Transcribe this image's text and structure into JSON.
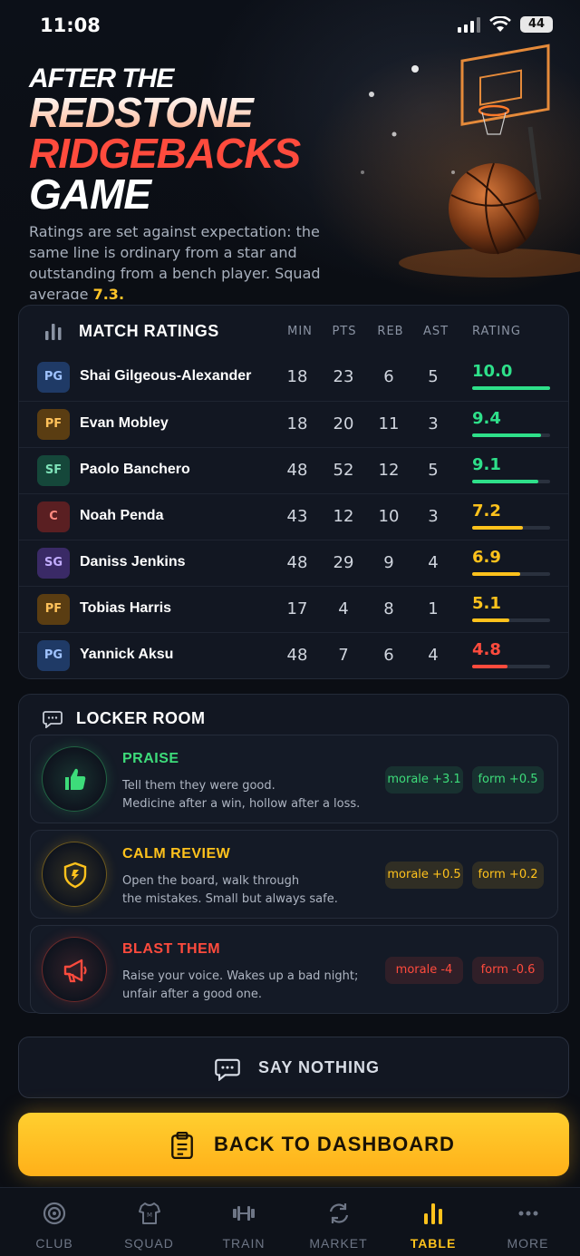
{
  "status": {
    "time": "11:08",
    "battery": "44"
  },
  "hero": {
    "title_line1": "AFTER THE",
    "title_line2": "REDSTONE",
    "title_line3": "RIDGEBACKS",
    "title_line4": "GAME",
    "subtitle": "Ratings are set against expectation: the same line is ordinary from a star and outstanding from a bench player. Squad average ",
    "squad_average": "7.3."
  },
  "ratings": {
    "title": "MATCH RATINGS",
    "columns": [
      "MIN",
      "PTS",
      "REB",
      "AST",
      "RATING"
    ],
    "players": [
      {
        "pos": "PG",
        "name": "Shai Gilgeous-Alexander",
        "min": "18",
        "pts": "23",
        "reb": "6",
        "ast": "5",
        "rating": "10.0",
        "level": 1.0,
        "color": "#2ee08a"
      },
      {
        "pos": "PF",
        "name": "Evan Mobley",
        "min": "18",
        "pts": "20",
        "reb": "11",
        "ast": "3",
        "rating": "9.4",
        "level": 0.88,
        "color": "#2ee08a"
      },
      {
        "pos": "SF",
        "name": "Paolo Banchero",
        "min": "48",
        "pts": "52",
        "reb": "12",
        "ast": "5",
        "rating": "9.1",
        "level": 0.85,
        "color": "#2ee08a"
      },
      {
        "pos": "C",
        "name": "Noah Penda",
        "min": "43",
        "pts": "12",
        "reb": "10",
        "ast": "3",
        "rating": "7.2",
        "level": 0.65,
        "color": "#ffc21c"
      },
      {
        "pos": "SG",
        "name": "Daniss Jenkins",
        "min": "48",
        "pts": "29",
        "reb": "9",
        "ast": "4",
        "rating": "6.9",
        "level": 0.62,
        "color": "#ffc21c"
      },
      {
        "pos": "PF",
        "name": "Tobias Harris",
        "min": "17",
        "pts": "4",
        "reb": "8",
        "ast": "1",
        "rating": "5.1",
        "level": 0.48,
        "color": "#ffc21c"
      },
      {
        "pos": "PG",
        "name": "Yannick Aksu",
        "min": "48",
        "pts": "7",
        "reb": "6",
        "ast": "4",
        "rating": "4.8",
        "level": 0.45,
        "color": "#ff4b3d"
      }
    ]
  },
  "locker": {
    "title": "LOCKER ROOM",
    "options": [
      {
        "title": "PRAISE",
        "desc1": "Tell them they were good.",
        "desc2": "Medicine after a win, hollow after a loss.",
        "morale": "morale +3.1",
        "form": "form +0.5",
        "color": "#3ddc7a",
        "icon": "thumbs-up-icon"
      },
      {
        "title": "CALM REVIEW",
        "desc1": "Open the board, walk through",
        "desc2": "the mistakes. Small but always safe.",
        "morale": "morale +0.5",
        "form": "form +0.2",
        "color": "#ffc21c",
        "icon": "shield-icon"
      },
      {
        "title": "BLAST THEM",
        "desc1": "Raise your voice. Wakes up a bad night;",
        "desc2": "unfair after a good one.",
        "morale": "morale -4",
        "form": "form -0.6",
        "color": "#ff4b3d",
        "icon": "megaphone-icon"
      }
    ]
  },
  "actions": {
    "say_nothing": "SAY NOTHING",
    "back": "BACK TO DASHBOARD"
  },
  "tabs": [
    {
      "label": "CLUB",
      "icon": "target-icon"
    },
    {
      "label": "SQUAD",
      "icon": "jersey-icon"
    },
    {
      "label": "TRAIN",
      "icon": "dumbbell-icon"
    },
    {
      "label": "MARKET",
      "icon": "swap-icon"
    },
    {
      "label": "TABLE",
      "icon": "bar-chart-icon",
      "active": true
    },
    {
      "label": "MORE",
      "icon": "more-icon"
    }
  ]
}
